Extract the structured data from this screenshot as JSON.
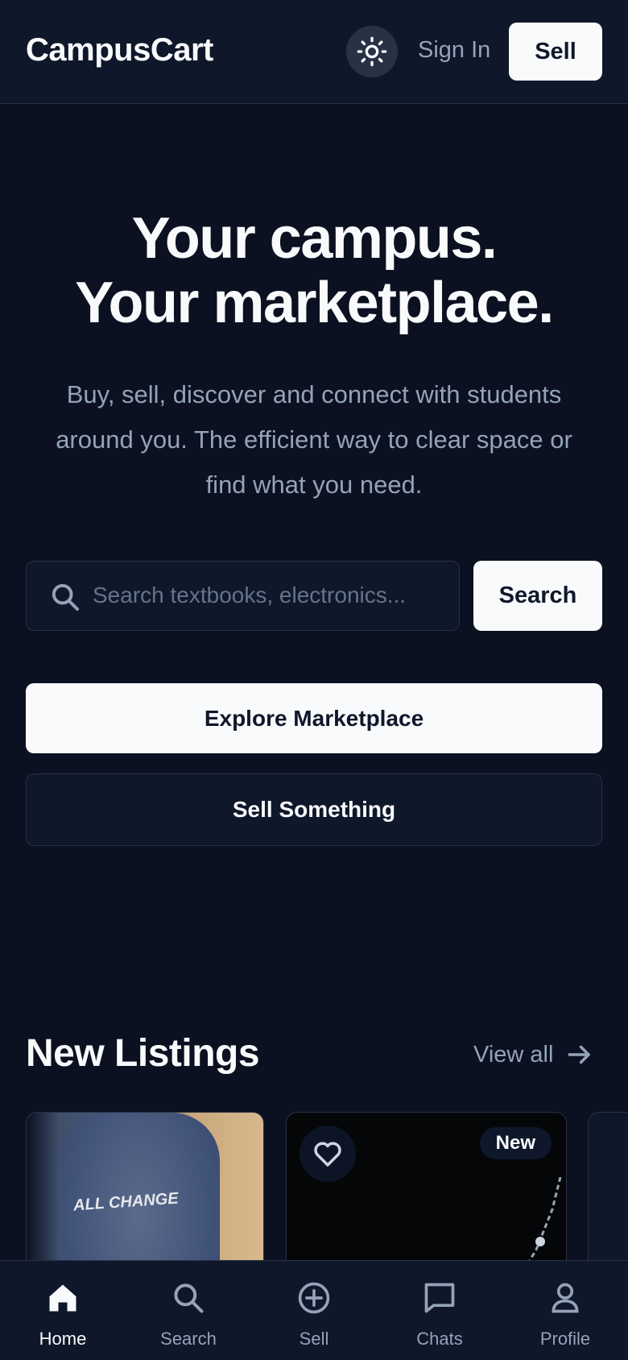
{
  "header": {
    "brand": "CampusCart",
    "theme_toggle_icon": "sun-icon",
    "sign_in_label": "Sign In",
    "sell_label": "Sell"
  },
  "hero": {
    "title_line1": "Your campus.",
    "title_line2": "Your marketplace.",
    "subtitle": "Buy, sell, discover and connect with students around you. The efficient way to clear space or find what you need.",
    "search_placeholder": "Search textbooks, electronics...",
    "search_button": "Search",
    "explore_button": "Explore Marketplace",
    "sell_something_button": "Sell Something"
  },
  "listings": {
    "title": "New Listings",
    "view_all_label": "View all",
    "cards": [
      {
        "image_text": "ALL CHANGE"
      },
      {
        "badge": "New"
      }
    ]
  },
  "bottom_nav": {
    "items": [
      {
        "label": "Home",
        "icon": "home-icon",
        "active": true
      },
      {
        "label": "Search",
        "icon": "search-icon",
        "active": false
      },
      {
        "label": "Sell",
        "icon": "plus-circle-icon",
        "active": false
      },
      {
        "label": "Chats",
        "icon": "chat-icon",
        "active": false
      },
      {
        "label": "Profile",
        "icon": "user-icon",
        "active": false
      }
    ]
  },
  "colors": {
    "background": "#0b1120",
    "surface": "#0f172a",
    "border": "#273244",
    "text_primary": "#f8fafc",
    "text_muted": "#94a3b8",
    "button_light": "#f8fafc"
  }
}
